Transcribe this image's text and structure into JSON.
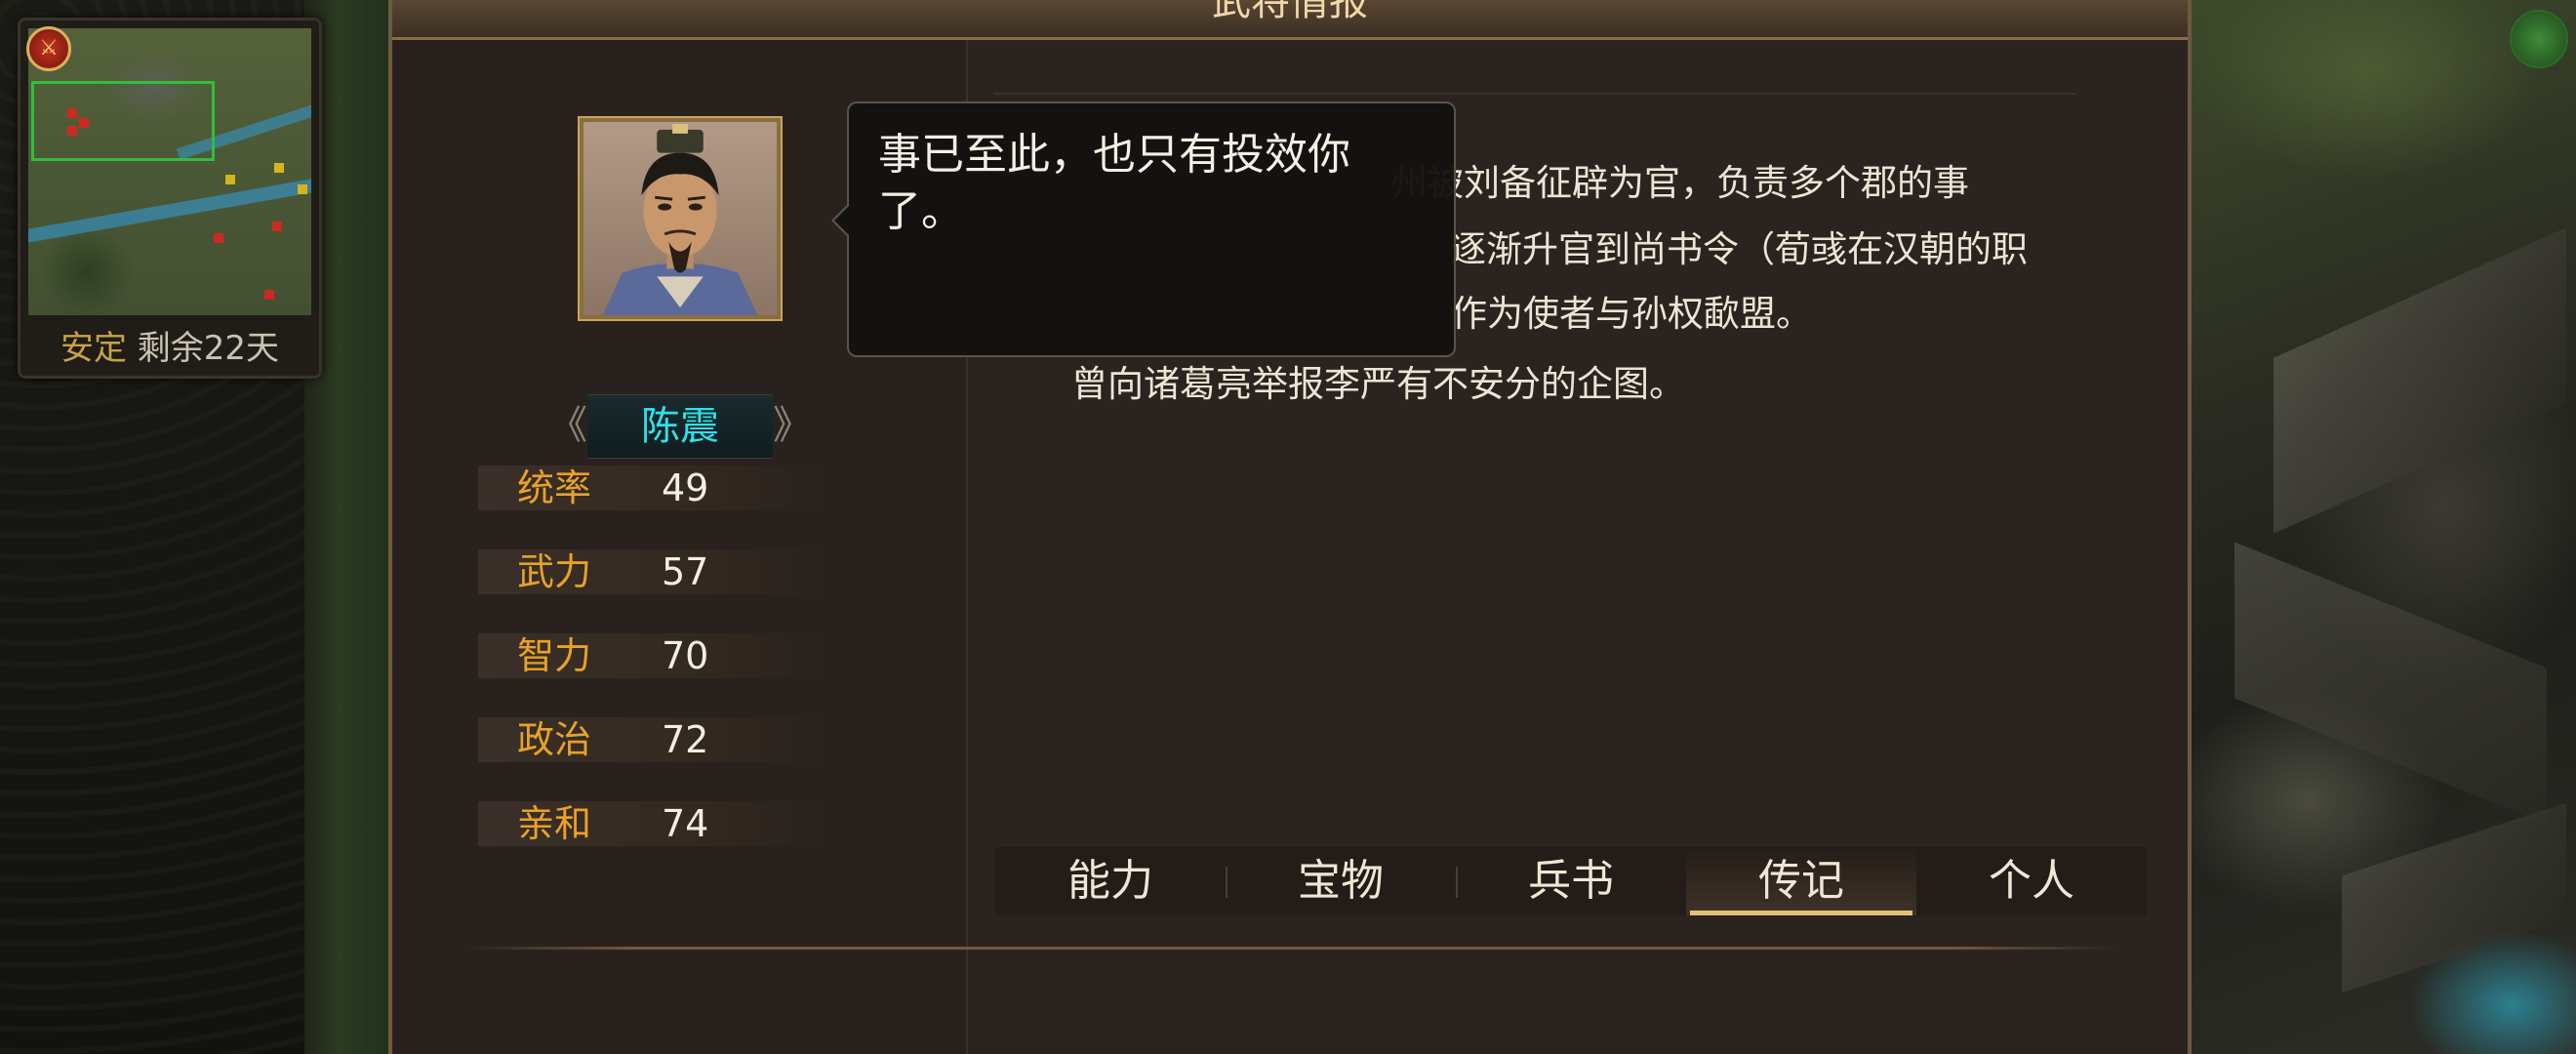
{
  "panel": {
    "title": "武将情报"
  },
  "minimap": {
    "status_label": "安定",
    "status_remaining": "剩余22天",
    "badge_icon": "sword-seal-icon",
    "colors": {
      "viewport": "#2fbf3a",
      "enemy": "#cc2a1e",
      "ally": "#d6b21e"
    }
  },
  "general": {
    "name": "陈震",
    "name_color": "#2fe0e6",
    "stats": [
      {
        "label": "统率",
        "value": "49"
      },
      {
        "label": "武力",
        "value": "57"
      },
      {
        "label": "智力",
        "value": "70"
      },
      {
        "label": "政治",
        "value": "72"
      },
      {
        "label": "亲和",
        "value": "74"
      }
    ]
  },
  "speech": {
    "text": "事已至此，也只有投效你了。"
  },
  "biography": {
    "lines": [
      "州被刘备征辟为官，负责多个郡的事",
      "逐渐升官到尚书令（荀彧在汉朝的职",
      "作为使者与孙权歃盟。",
      "曾向诸葛亮举报李严有不安分的企图。"
    ]
  },
  "tabs": [
    {
      "label": "能力",
      "active": false
    },
    {
      "label": "宝物",
      "active": false
    },
    {
      "label": "兵书",
      "active": false
    },
    {
      "label": "传记",
      "active": true
    },
    {
      "label": "个人",
      "active": false
    }
  ],
  "accent_color": "#e8a227"
}
